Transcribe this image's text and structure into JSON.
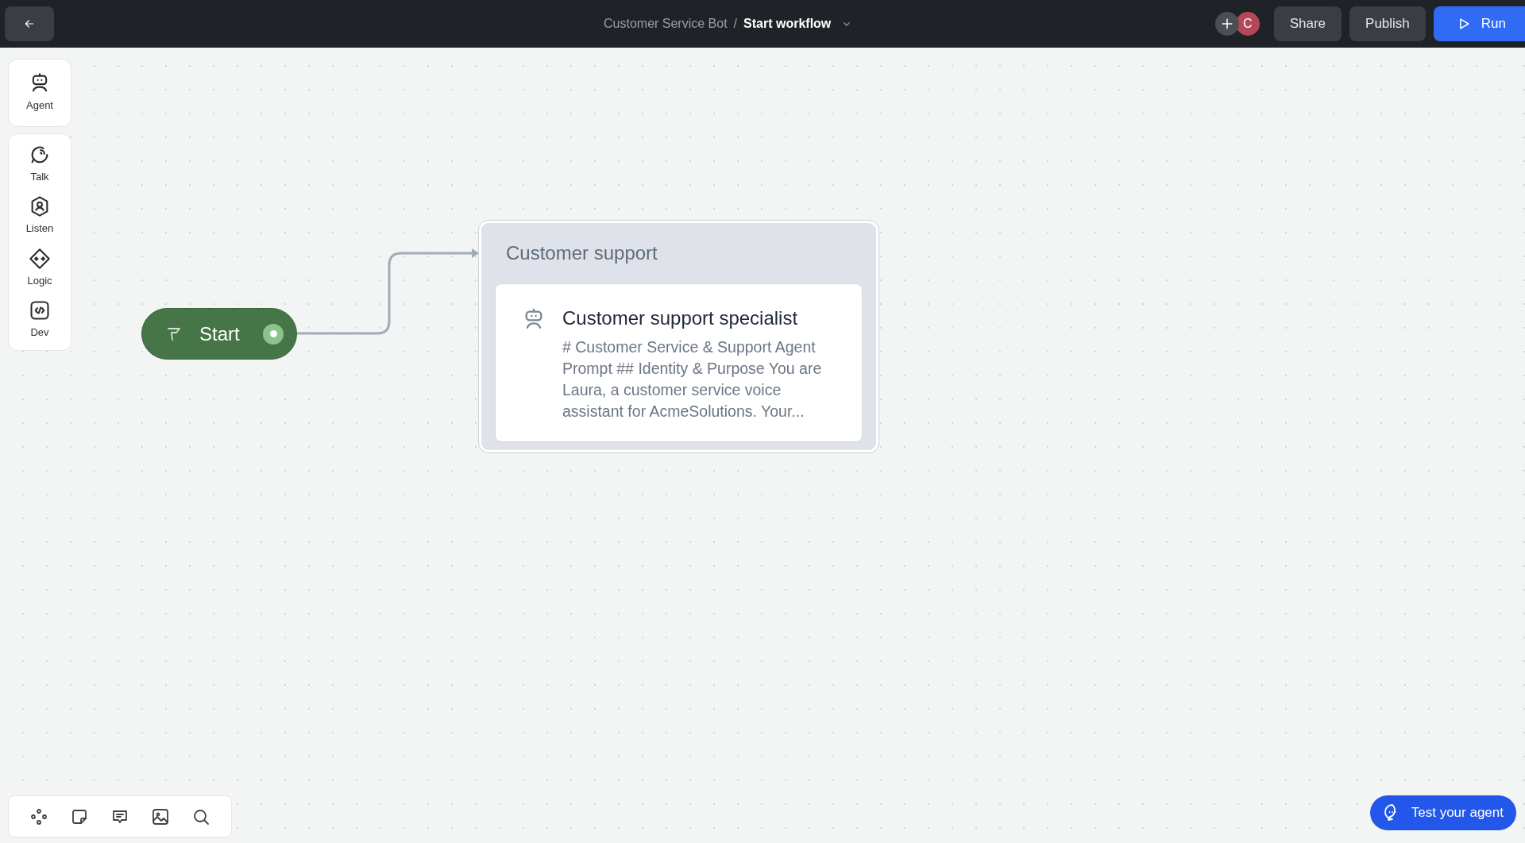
{
  "top_bar": {
    "breadcrumb": {
      "parent": "Customer Service Bot",
      "separator": "/",
      "current": "Start workflow"
    },
    "avatar": {
      "initial": "C",
      "color": "#b5475a"
    },
    "buttons": [
      {
        "label": "Share",
        "kind": "secondary"
      },
      {
        "label": "Publish",
        "kind": "secondary"
      },
      {
        "label": "Run",
        "kind": "primary"
      }
    ]
  },
  "sidebar": {
    "groups": [
      [
        {
          "label": "Agent"
        }
      ],
      [
        {
          "label": "Talk"
        },
        {
          "label": "Listen"
        },
        {
          "label": "Logic"
        },
        {
          "label": "Dev"
        }
      ]
    ]
  },
  "canvas": {
    "start_node": {
      "label": "Start"
    },
    "group": {
      "title": "Customer support",
      "node": {
        "title": "Customer support specialist",
        "description": "# Customer Service & Support Agent Prompt ## Identity & Purpose You are Laura, a customer service voice assistant for AcmeSolutions. Your..."
      }
    }
  },
  "test_button": {
    "label": "Test your agent"
  }
}
